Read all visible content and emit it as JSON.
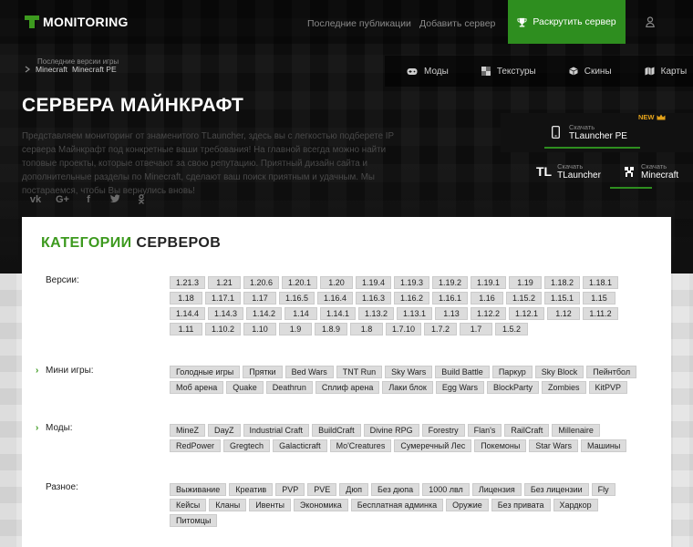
{
  "header": {
    "logo_text": "MONITORING",
    "nav": [
      "Последние публикации",
      "Добавить сервер"
    ],
    "promote_label": "Раскрутить сервер"
  },
  "breadcrumb": {
    "hint": "Последние версии игры",
    "items": [
      "Minecraft",
      "Minecraft PE"
    ]
  },
  "tabs": [
    {
      "label": "Моды",
      "icon": "gamepad-icon"
    },
    {
      "label": "Текстуры",
      "icon": "texture-icon"
    },
    {
      "label": "Скины",
      "icon": "cube-icon"
    },
    {
      "label": "Карты",
      "icon": "map-icon"
    }
  ],
  "page": {
    "title": "СЕРВЕРА МАЙНКРАФТ",
    "description": "Представляем мониторинг от знаменитого TLauncher, здесь вы с легкостью подберете IP сервера Майнкрафт под конкретные ваши требования! На главной всегда можно найти топовые проекты, которые отвечают за свою репутацию. Приятный дизайн сайта и дополнительные разделы по Minecraft, сделают ваш поиск приятным и удачным. Мы постараемся, чтобы Вы вернулись вновь!"
  },
  "socials": [
    "vk-icon",
    "google-plus-icon",
    "facebook-icon",
    "twitter-icon",
    "odnoklassniki-icon"
  ],
  "downloads": {
    "new_badge": "NEW",
    "sub_label": "Скачать",
    "items": [
      "TLauncher PE",
      "TLauncher",
      "Minecraft"
    ],
    "tl_logo": "TL"
  },
  "categories": {
    "title_accent": "КАТЕГОРИИ",
    "title_rest": "СЕРВЕРОВ",
    "groups": [
      {
        "label": "Версии:",
        "tags": [
          "1.21.3",
          "1.21",
          "1.20.6",
          "1.20.1",
          "1.20",
          "1.19.4",
          "1.19.3",
          "1.19.2",
          "1.19.1",
          "1.19",
          "1.18.2",
          "1.18.1",
          "1.18",
          "1.17.1",
          "1.17",
          "1.16.5",
          "1.16.4",
          "1.16.3",
          "1.16.2",
          "1.16.1",
          "1.16",
          "1.15.2",
          "1.15.1",
          "1.15",
          "1.14.4",
          "1.14.3",
          "1.14.2",
          "1.14",
          "1.14.1",
          "1.13.2",
          "1.13.1",
          "1.13",
          "1.12.2",
          "1.12.1",
          "1.12",
          "1.11.2",
          "1.11",
          "1.10.2",
          "1.10",
          "1.9",
          "1.8.9",
          "1.8",
          "1.7.10",
          "1.7.2",
          "1.7",
          "1.5.2"
        ]
      },
      {
        "label": "Мини игры:",
        "tags": [
          "Голодные игры",
          "Прятки",
          "Bed Wars",
          "TNT Run",
          "Sky Wars",
          "Build Battle",
          "Паркур",
          "Sky Block",
          "Пейнтбол",
          "Моб арена",
          "Quake",
          "Deathrun",
          "Сплиф арена",
          "Лаки блок",
          "Egg Wars",
          "BlockParty",
          "Zombies",
          "KitPVP"
        ]
      },
      {
        "label": "Моды:",
        "tags": [
          "MineZ",
          "DayZ",
          "Industrial Craft",
          "BuildCraft",
          "Divine RPG",
          "Forestry",
          "Flan's",
          "RailCraft",
          "Millenaire",
          "RedPower",
          "Gregtech",
          "Galacticraft",
          "Mo'Creatures",
          "Сумеречный Лес",
          "Покемоны",
          "Star Wars",
          "Машины"
        ]
      },
      {
        "label": "Разное:",
        "tags": [
          "Выживание",
          "Креатив",
          "PVP",
          "PVE",
          "Дюп",
          "Без дюпа",
          "1000 лвл",
          "Лицензия",
          "Без лицензии",
          "Fly",
          "Кейсы",
          "Кланы",
          "Ивенты",
          "Экономика",
          "Бесплатная админка",
          "Оружие",
          "Без привата",
          "Хардкор",
          "Питомцы"
        ]
      }
    ]
  },
  "colors": {
    "accent": "#3d9a1f",
    "promote": "#2e8e1f",
    "badge": "#e3a21a"
  }
}
